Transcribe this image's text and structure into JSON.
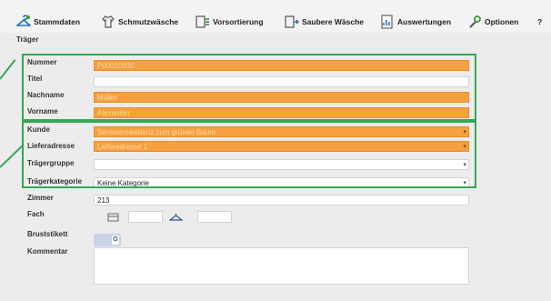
{
  "toolbar": {
    "items": [
      {
        "label": "Stammdaten",
        "icon": "hanger-icon"
      },
      {
        "label": "Schmutzwäsche",
        "icon": "shirt-icon"
      },
      {
        "label": "Vorsortierung",
        "icon": "sort-icon"
      },
      {
        "label": "Saubere Wäsche",
        "icon": "clean-laundry-icon"
      },
      {
        "label": "Auswertungen",
        "icon": "report-icon"
      },
      {
        "label": "Optionen",
        "icon": "wrench-icon"
      },
      {
        "label": "?",
        "icon": "help-icon"
      }
    ]
  },
  "page": {
    "title": "Träger"
  },
  "form": {
    "nummer": {
      "label": "Nummer",
      "value": "P00010030"
    },
    "titel": {
      "label": "Titel",
      "value": ""
    },
    "nachname": {
      "label": "Nachname",
      "value": "Müller"
    },
    "vorname": {
      "label": "Vorname",
      "value": "Alexander"
    },
    "kunde": {
      "label": "Kunde",
      "value": "Seniorenresidenz zum grünen Baum"
    },
    "lieferadresse": {
      "label": "Lieferadresse",
      "value": "Lieferadresse 1"
    },
    "traegergruppe": {
      "label": "Trägergruppe",
      "value": ""
    },
    "traegerkategorie": {
      "label": "Trägerkategorie",
      "value": "Keine Kategorie"
    },
    "zimmer": {
      "label": "Zimmer",
      "value": "213"
    },
    "fach": {
      "label": "Fach",
      "value_1": "",
      "value_2": ""
    },
    "bewohneretikett": {
      "label": "Bruststikett",
      "toggle_text": "O"
    },
    "kommentar": {
      "label": "Kommentar",
      "value": ""
    }
  },
  "colors": {
    "highlight": "#f7a040",
    "callout": "#34a853"
  }
}
